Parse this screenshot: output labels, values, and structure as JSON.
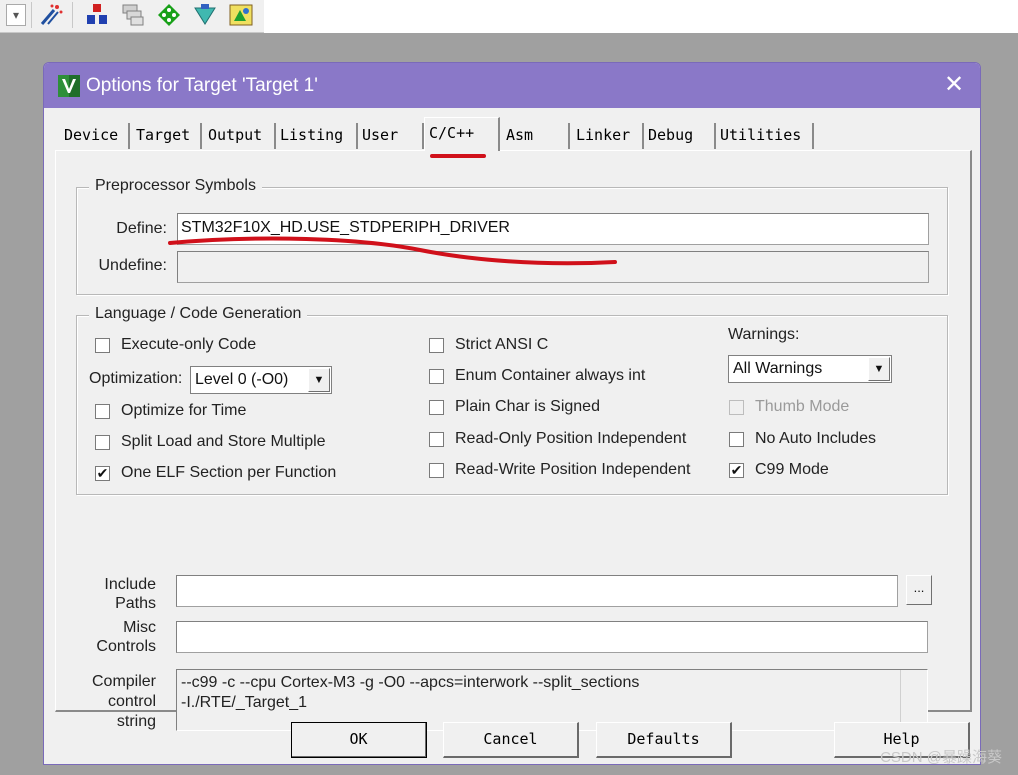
{
  "dialog": {
    "title": "Options for Target 'Target 1'",
    "close_glyph": "✕"
  },
  "tabs": [
    {
      "label": "Device"
    },
    {
      "label": "Target"
    },
    {
      "label": "Output"
    },
    {
      "label": "Listing"
    },
    {
      "label": "User"
    },
    {
      "label": "C/C++",
      "active": true
    },
    {
      "label": "Asm"
    },
    {
      "label": "Linker"
    },
    {
      "label": "Debug"
    },
    {
      "label": "Utilities"
    }
  ],
  "preprocessor": {
    "group_title": "Preprocessor Symbols",
    "define_label": "Define:",
    "define_value": "STM32F10X_HD.USE_STDPERIPH_DRIVER",
    "undefine_label": "Undefine:",
    "undefine_value": ""
  },
  "language": {
    "group_title": "Language / Code Generation",
    "execute_only": {
      "label": "Execute-only Code",
      "checked": false
    },
    "optimization_label": "Optimization:",
    "optimization_value": "Level 0 (-O0)",
    "optimize_time": {
      "label": "Optimize for Time",
      "checked": false
    },
    "split_load": {
      "label": "Split Load and Store Multiple",
      "checked": false
    },
    "one_elf": {
      "label": "One ELF Section per Function",
      "checked": true
    },
    "strict_ansi": {
      "label": "Strict ANSI C",
      "checked": false
    },
    "enum_container": {
      "label": "Enum Container always int",
      "checked": false
    },
    "plain_char": {
      "label": "Plain Char is Signed",
      "checked": false
    },
    "ropi": {
      "label": "Read-Only Position Independent",
      "checked": false
    },
    "rwpi": {
      "label": "Read-Write Position Independent",
      "checked": false
    },
    "warnings_label": "Warnings:",
    "warnings_value": "All Warnings",
    "thumb_mode": {
      "label": "Thumb Mode",
      "checked": false,
      "disabled": true
    },
    "no_auto_includes": {
      "label": "No Auto Includes",
      "checked": false
    },
    "c99_mode": {
      "label": "C99 Mode",
      "checked": true
    }
  },
  "paths": {
    "include_label_1": "Include",
    "include_label_2": "Paths",
    "include_value": "",
    "browse_label": "...",
    "misc_label_1": "Misc",
    "misc_label_2": "Controls",
    "misc_value": ""
  },
  "compiler": {
    "label_1": "Compiler",
    "label_2": "control",
    "label_3": "string",
    "lines": [
      "--c99 -c --cpu Cortex-M3 -g -O0 --apcs=interwork --split_sections",
      "-I./RTE/_Target_1"
    ]
  },
  "buttons": {
    "ok": "OK",
    "cancel": "Cancel",
    "defaults": "Defaults",
    "help": "Help"
  },
  "toolbar": {
    "dropdown_glyph": "▾"
  },
  "watermark": "CSDN @暴躁海葵",
  "colors": {
    "titlebar": "#8a78c8",
    "annotation_red": "#d0101a",
    "dialog_bg": "#f0f0f0"
  }
}
